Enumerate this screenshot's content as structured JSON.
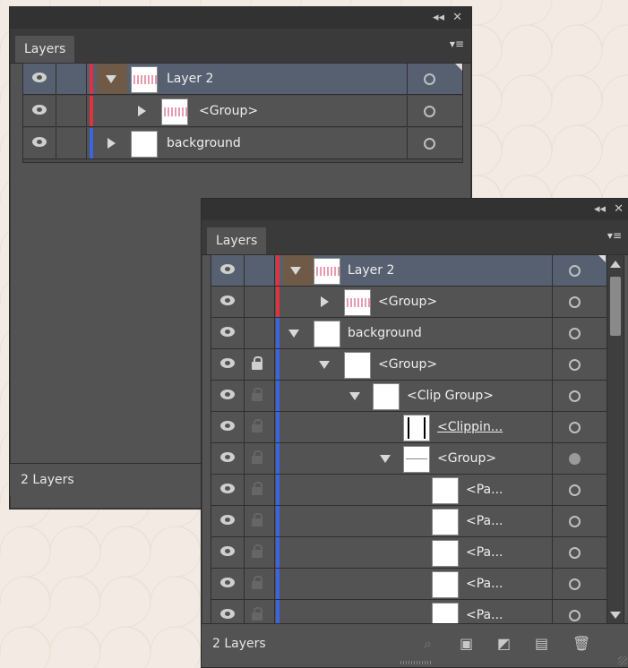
{
  "panel_back": {
    "tab_label": "Layers",
    "collapse_glyph": "◂◂",
    "close_glyph": "✕",
    "menu_glyph": "▾≡",
    "status": "2 Layers",
    "rows": [
      {
        "name": "Layer 2",
        "color": "#e0313e"
      },
      {
        "name": "<Group>",
        "color": "#e0313e"
      },
      {
        "name": "background",
        "color": "#3b64e0"
      }
    ]
  },
  "panel_front": {
    "tab_label": "Layers",
    "collapse_glyph": "◂◂",
    "close_glyph": "✕",
    "menu_glyph": "▾≡",
    "status": "2 Layers",
    "rows": [
      {
        "name": "Layer 2"
      },
      {
        "name": "<Group>"
      },
      {
        "name": "background"
      },
      {
        "name": "<Group>"
      },
      {
        "name": "<Clip Group>"
      },
      {
        "name": "<Clippin..."
      },
      {
        "name": "<Group>"
      },
      {
        "name": "<Pa..."
      },
      {
        "name": "<Pa..."
      },
      {
        "name": "<Pa..."
      },
      {
        "name": "<Pa..."
      },
      {
        "name": "<Pa..."
      }
    ],
    "footer_icons": [
      "search-icon",
      "collect-for-export-icon",
      "make-clipping-mask-icon",
      "new-sublayer-icon",
      "new-layer-icon",
      "delete-icon"
    ]
  },
  "colors": {
    "panel_bg": "#535353",
    "selected_row": "#566070",
    "layer_red": "#e0313e",
    "layer_blue": "#3b64e0",
    "page_bg": "#f3ebe3"
  }
}
